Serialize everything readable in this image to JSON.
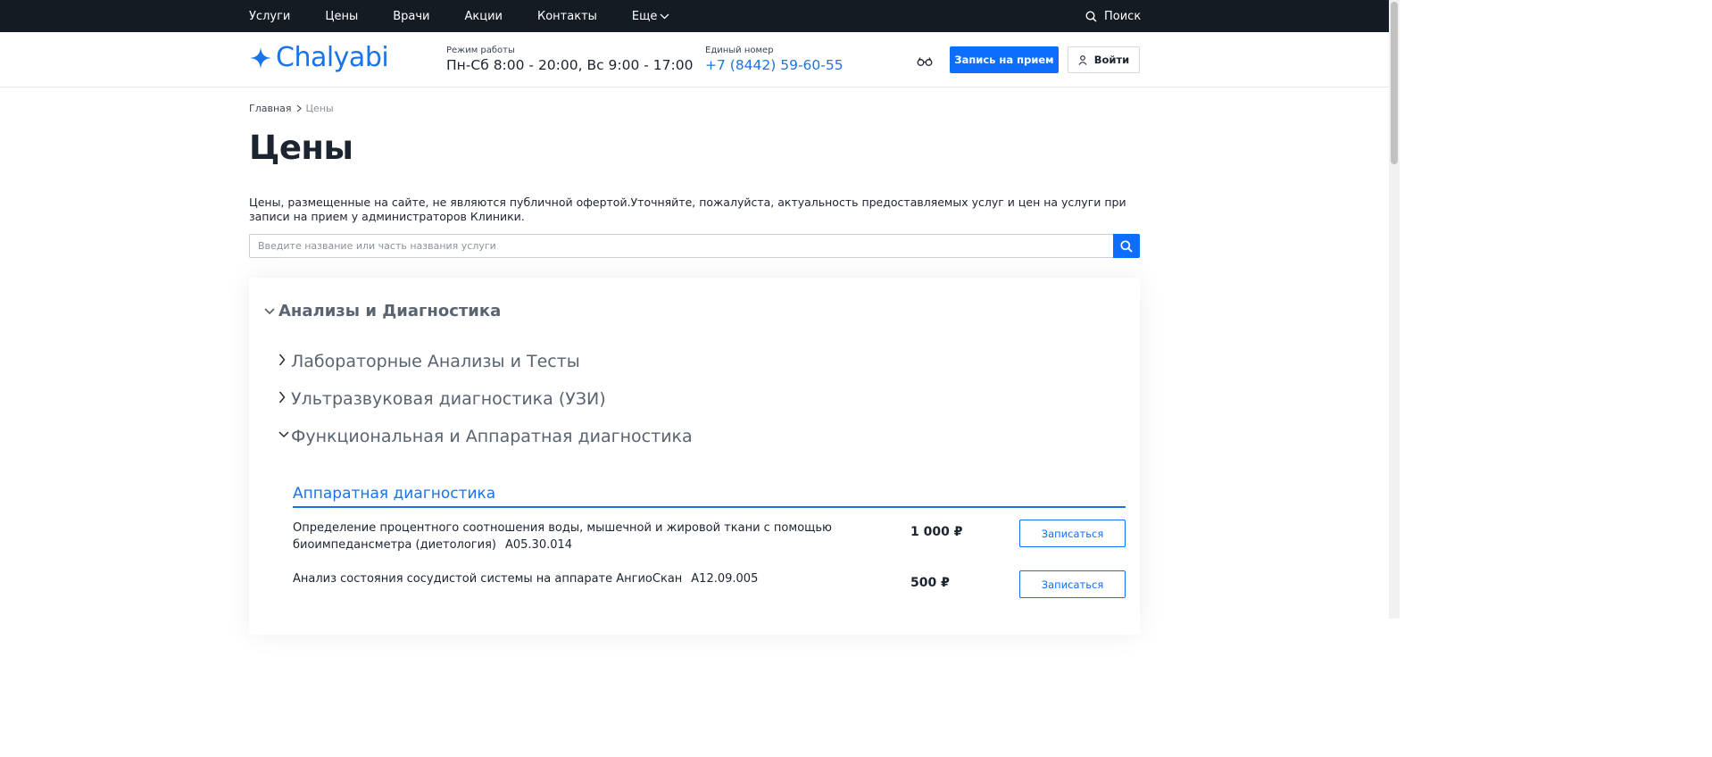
{
  "topnav": {
    "items": [
      {
        "label": "Услуги"
      },
      {
        "label": "Цены"
      },
      {
        "label": "Врачи"
      },
      {
        "label": "Акции"
      },
      {
        "label": "Контакты"
      },
      {
        "label": "Еще"
      }
    ],
    "search_label": "Поиск"
  },
  "header": {
    "logo_text": "Chalyabi",
    "hours_label": "Режим работы",
    "hours_value": "Пн-Сб 8:00 - 20:00, Вс 9:00 - 17:00",
    "phone_label": "Единый номер",
    "phone_value": "+7 (8442) 59-60-55",
    "appoint_label": "Запись на прием",
    "login_label": "Войти"
  },
  "breadcrumb": {
    "home": "Главная",
    "current": "Цены"
  },
  "page": {
    "title": "Цены",
    "disclaimer": "Цены, размещенные на сайте, не являются публичной офертой.Уточняйте, пожалуйста, актуальность предоставляемых услуг и цен на услуги при записи на прием у администраторов Клиники.",
    "search_placeholder": "Введите название или часть названия услуги"
  },
  "catalog": {
    "category": "Анализы и Диагностика",
    "subcategories": [
      {
        "label": "Лабораторные Анализы и Тесты",
        "expanded": false
      },
      {
        "label": "Ультразвуковая диагностика (УЗИ)",
        "expanded": false
      },
      {
        "label": "Функциональная и Аппаратная диагностика",
        "expanded": true
      }
    ],
    "group": "Аппаратная диагностика",
    "services": [
      {
        "name": "Определение процентного соотношения воды, мышечной и жировой ткани с помощью биоимпедансметра (диетология)",
        "code": "A05.30.014",
        "price": "1 000 ₽",
        "button": "Записаться"
      },
      {
        "name": "Анализ состояния сосудистой системы на аппарате АнгиоСкан",
        "code": "A12.09.005",
        "price": "500 ₽",
        "button": "Записаться"
      }
    ]
  },
  "colors": {
    "topbar": "#151b23",
    "accent": "#0d6efd",
    "link": "#1a73e8",
    "heading_muted": "#5a6470"
  }
}
